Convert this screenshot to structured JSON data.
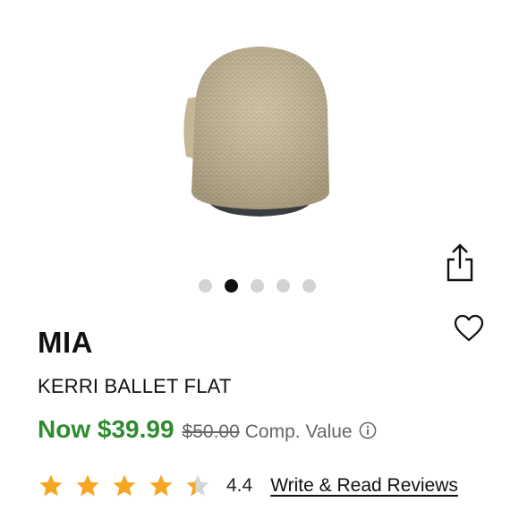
{
  "product": {
    "brand": "MIA",
    "name": "KERRI BALLET FLAT",
    "image_icon": "shoe-heel-view"
  },
  "carousel": {
    "count": 5,
    "active_index": 1
  },
  "price": {
    "sale": "Now $39.99",
    "original": "$50.00",
    "comp_label": "Comp. Value"
  },
  "rating": {
    "value": "4.4",
    "stars": 4.4,
    "max": 5,
    "reviews_link": "Write & Read Reviews"
  },
  "colors": {
    "sale_price": "#2e8b2e",
    "star": "#f5a623",
    "star_empty": "#d6d6d6",
    "shoe_knit": "#cbbd9c",
    "sole": "#3a3d40"
  },
  "icons": {
    "share": "share-icon",
    "favorite": "heart-icon",
    "info": "info-icon",
    "star": "star-icon"
  }
}
